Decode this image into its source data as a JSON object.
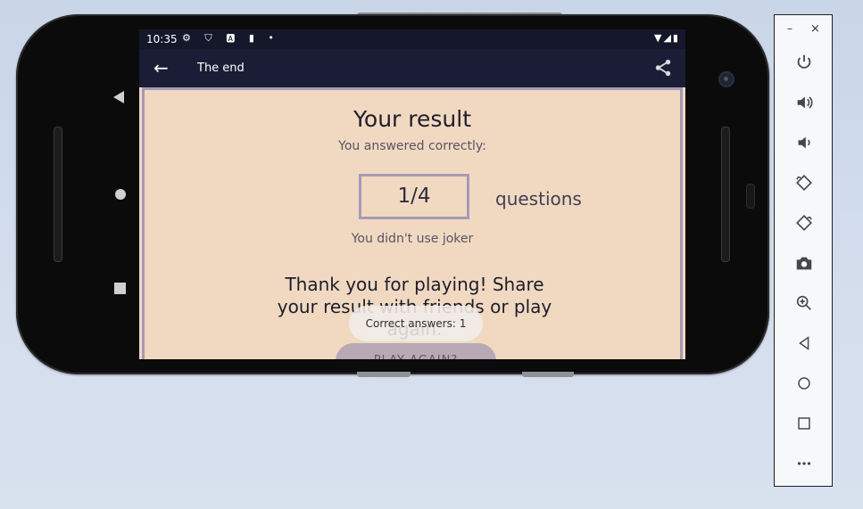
{
  "status_bar": {
    "time": "10:35",
    "left_icons": "⚙ ⛉ 🅰 ▮ •",
    "right_icons": "▼◢▮"
  },
  "app_bar": {
    "title": "The end"
  },
  "result": {
    "title": "Your result",
    "subtitle": "You answered correctly:",
    "score": "1/4",
    "score_unit": "questions",
    "joker_text": "You didn't use joker",
    "thanks_text": "Thank you for playing! Share your result with friends or play again.",
    "toast": "Correct answers: 1",
    "play_again": "PLAY AGAIN?"
  },
  "colors": {
    "background": "#f1d9c1",
    "accent": "#a59ab7",
    "appbar": "#1a1d35"
  },
  "emulator_panel": {
    "minimize": "–",
    "close": "×"
  }
}
